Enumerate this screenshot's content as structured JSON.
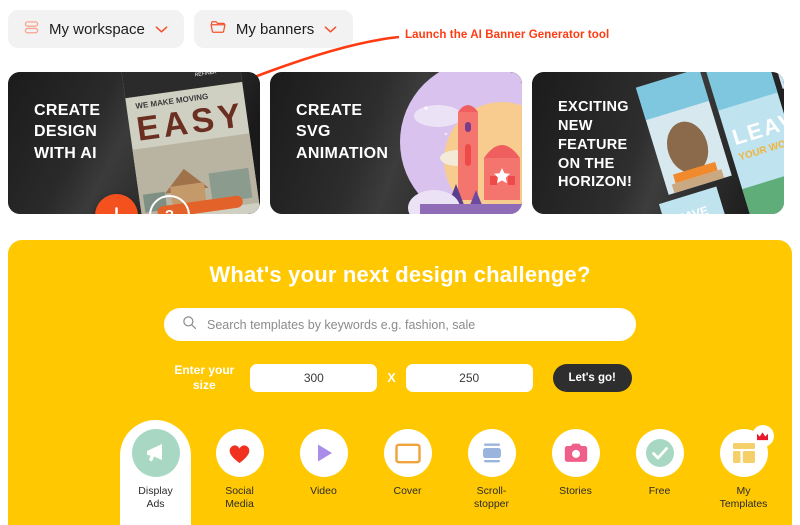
{
  "topbar": {
    "chips": [
      {
        "label": "My workspace",
        "icon": "stacked-layers-icon"
      },
      {
        "label": "My banners",
        "icon": "folder-icon"
      }
    ]
  },
  "annotation": {
    "text": "Launch the AI Banner Generator tool",
    "color": "#ff3b12"
  },
  "cards": [
    {
      "title": "CREATE\nDESIGN\nWITH AI",
      "art": "moving-company-poster",
      "plus_label": "+",
      "help_label": "?"
    },
    {
      "title": "CREATE\nSVG\nANIMATION",
      "art": "castle-illustration"
    },
    {
      "title": "EXCITING\nNEW\nFEATURE\nON THE\nHORIZON!",
      "art": "beach-banners"
    }
  ],
  "panel": {
    "background": "#ffc800",
    "title": "What's your next design challenge?",
    "search": {
      "placeholder": "Search templates by keywords e.g. fashion, sale",
      "value": "",
      "icon": "search-icon"
    },
    "size": {
      "label": "Enter your\nsize",
      "width_value": "300",
      "separator": "X",
      "height_value": "250",
      "go_label": "Let's go!"
    },
    "categories": [
      {
        "label": "Display\nAds",
        "icon": "megaphone-icon",
        "active": true,
        "color": "#ffffff",
        "bg": "#a8d8c4"
      },
      {
        "label": "Social\nMedia",
        "icon": "heart-icon",
        "active": false,
        "color": "#f0321f",
        "bg": "#ffffff"
      },
      {
        "label": "Video",
        "icon": "play-icon",
        "active": false,
        "color": "#a98de8",
        "bg": "#ffffff"
      },
      {
        "label": "Cover",
        "icon": "rectangle-icon",
        "active": false,
        "color": "#f0a33c",
        "bg": "#ffffff"
      },
      {
        "label": "Scroll-\nstopper",
        "icon": "scroll-icon",
        "active": false,
        "color": "#9ab4dd",
        "bg": "#ffffff"
      },
      {
        "label": "Stories",
        "icon": "camera-icon",
        "active": false,
        "color": "#ef5f8a",
        "bg": "#ffffff"
      },
      {
        "label": "Free",
        "icon": "check-circle-icon",
        "active": false,
        "color": "#a8d8c4",
        "bg": "#ffffff"
      },
      {
        "label": "My\nTemplates",
        "icon": "layout-icon",
        "active": false,
        "color": "#f5cf6a",
        "bg": "#ffffff",
        "badge": "crown-icon"
      }
    ]
  }
}
